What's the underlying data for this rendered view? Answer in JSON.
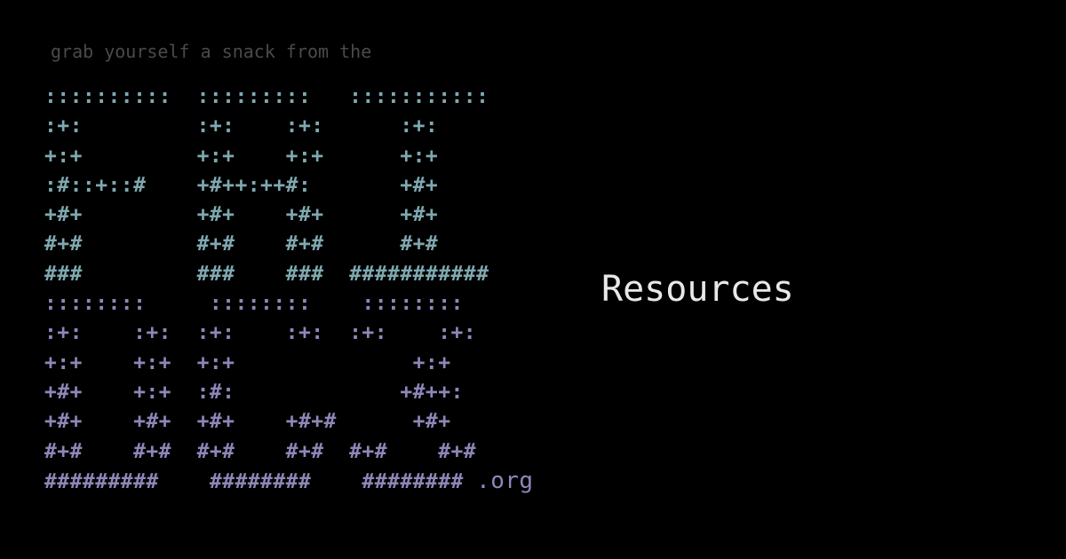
{
  "tagline": "grab yourself a snack from the",
  "ascii_logo": {
    "top_rows": [
      "::::::::::  :::::::::   :::::::::::",
      ":+:         :+:    :+:      :+:",
      "+:+         +:+    +:+      +:+",
      ":#::+::#    +#++:++#:       +#+",
      "+#+         +#+    +#+      +#+",
      "#+#         #+#    #+#      #+#",
      "###         ###    ###  ###########"
    ],
    "bottom_rows": [
      "::::::::     ::::::::    ::::::::",
      ":+:    :+:  :+:    :+:  :+:    :+:",
      "+:+    +:+  +:+              +:+",
      "+#+    +:+  :#:             +#++:",
      "+#+    +#+  +#+    +#+#      +#+",
      "#+#    #+#  #+#    #+#  #+#    #+#",
      "#########    ########    ########"
    ],
    "suffix": ".org"
  },
  "headline": "Resources",
  "colors": {
    "background": "#000000",
    "tagline": "#4a4a4a",
    "logo_top": "#7fa8b0",
    "logo_bottom": "#8f86b8",
    "headline": "#e8e8e8"
  }
}
